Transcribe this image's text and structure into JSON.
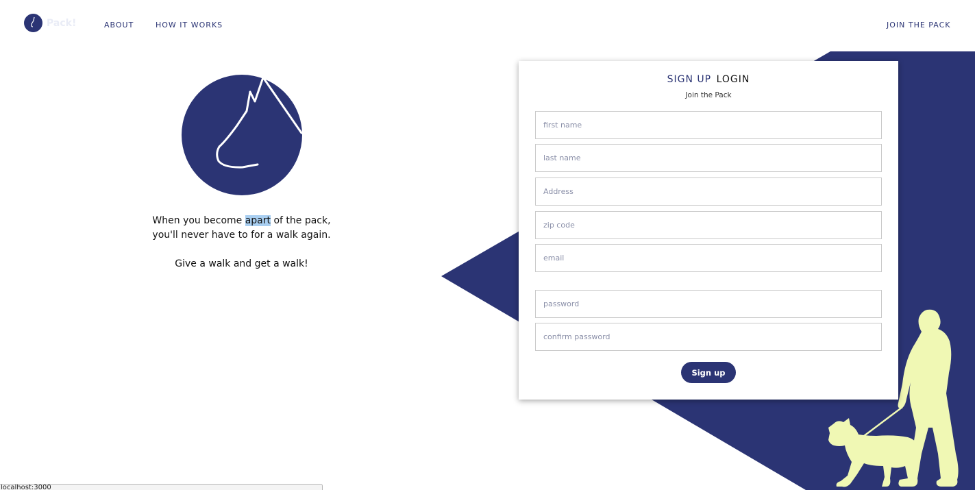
{
  "header": {
    "logo_text": "Pack!",
    "nav": {
      "about": "ABOUT",
      "how_it_works": "HOW IT WORKS",
      "join": "JOIN THE PACK"
    }
  },
  "hero": {
    "line1_before": "When you become ",
    "line1_highlight": "apart",
    "line1_after": " of the pack,",
    "line2": "you'll never have to for a walk again.",
    "line3": "Give a walk and get a walk!"
  },
  "form": {
    "tab_signup": "SIGN UP",
    "tab_login": "LOGIN",
    "subtitle": "Join the Pack",
    "fields": {
      "first_name": {
        "placeholder": "first name",
        "value": ""
      },
      "last_name": {
        "placeholder": "last name",
        "value": ""
      },
      "address": {
        "placeholder": "Address",
        "value": ""
      },
      "zip": {
        "placeholder": "zip code",
        "value": ""
      },
      "email": {
        "placeholder": "email",
        "value": ""
      },
      "password": {
        "placeholder": "password",
        "value": ""
      },
      "confirm_password": {
        "placeholder": "confirm password",
        "value": ""
      }
    },
    "submit_label": "Sign up"
  },
  "status_bar": {
    "text": "localhost:3000"
  },
  "icons": {
    "logo": "wolf-head-icon",
    "hero": "wolf-head-icon",
    "decoration": "person-walking-dog-silhouette"
  },
  "colors": {
    "brand_navy": "#2b3474",
    "silhouette": "#f0f8b4",
    "highlight": "#a9cff1"
  }
}
